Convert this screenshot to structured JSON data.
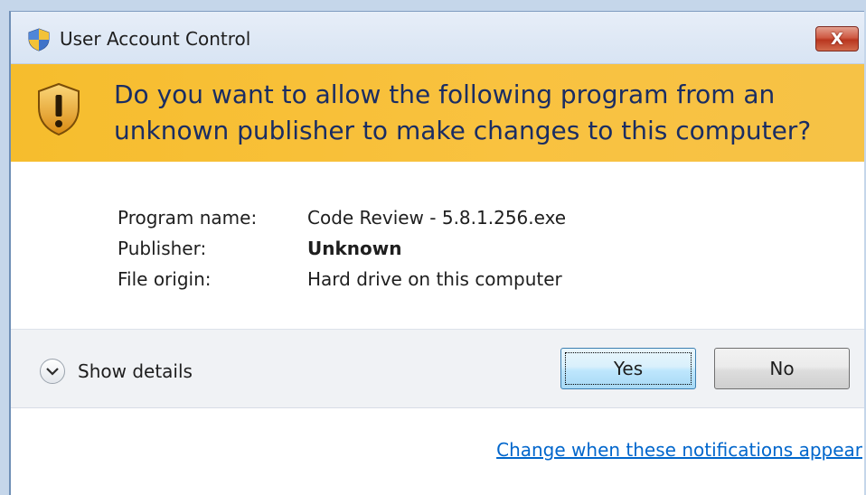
{
  "window": {
    "title": "User Account Control",
    "close_symbol": "X"
  },
  "banner": {
    "question": "Do you want to allow the following program from an unknown publisher to make changes to this computer?"
  },
  "info": {
    "rows": [
      {
        "label": "Program name:",
        "value": "Code Review - 5.8.1.256.exe"
      },
      {
        "label": "Publisher:",
        "value": "Unknown"
      },
      {
        "label": "File origin:",
        "value": "Hard drive on this computer"
      }
    ]
  },
  "controls": {
    "show_details": "Show details",
    "yes_label": "Yes",
    "no_label": "No"
  },
  "footer": {
    "change_link": "Change when these notifications appear"
  },
  "icons": {
    "title_icon": "uac-shield-icon",
    "banner_icon": "warning-shield-icon",
    "chevron": "chevron-down-icon"
  },
  "colors": {
    "banner": "#f6bd2d",
    "question_text": "#1a2d63",
    "link": "#0066cc",
    "close_button": "#c8442c"
  }
}
